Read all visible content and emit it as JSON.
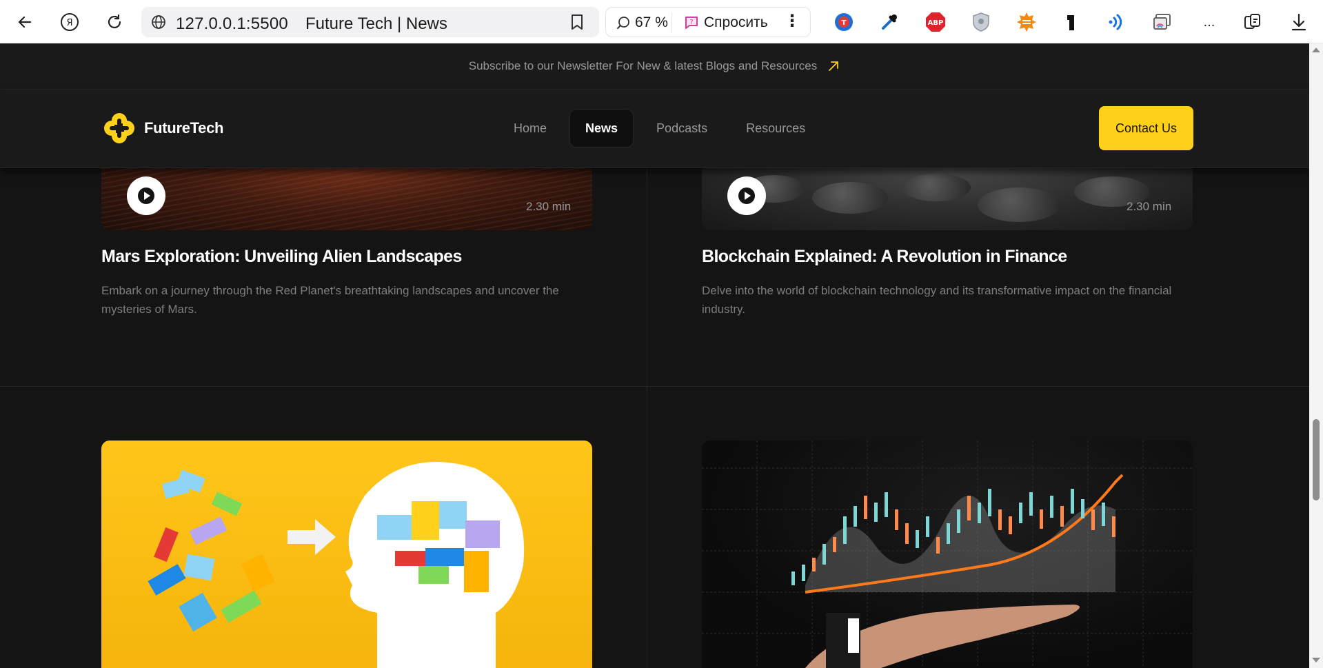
{
  "browser": {
    "url": "127.0.0.1:5500",
    "tab_title": "Future Tech | News",
    "zoom": "67 %",
    "ask_label": "Спросить",
    "more_label": "...",
    "extensions": [
      "translate-icon",
      "eyedropper-icon",
      "adblock-icon",
      "shield-icon",
      "sun-icon",
      "one-icon",
      "wifi-icon",
      "cast-icon"
    ],
    "abp_label": "ABP"
  },
  "newsletter": {
    "text": "Subscribe to our Newsletter For New & latest Blogs and Resources"
  },
  "header": {
    "logo_text": "FutureTech",
    "nav": [
      {
        "label": "Home",
        "active": false
      },
      {
        "label": "News",
        "active": true
      },
      {
        "label": "Podcasts",
        "active": false
      },
      {
        "label": "Resources",
        "active": false
      }
    ],
    "contact_label": "Contact Us",
    "accent": "#ffd11a"
  },
  "cards": [
    {
      "duration": "2.30 min",
      "title": "Mars Exploration: Unveiling Alien Landscapes",
      "description": "Embark on a journey through the Red Planet's breathtaking landscapes and uncover the mysteries of Mars."
    },
    {
      "duration": "2.30 min",
      "title": "Blockchain Explained: A Revolution in Finance",
      "description": "Delve into the world of blockchain technology and its transformative impact on the financial industry."
    }
  ]
}
